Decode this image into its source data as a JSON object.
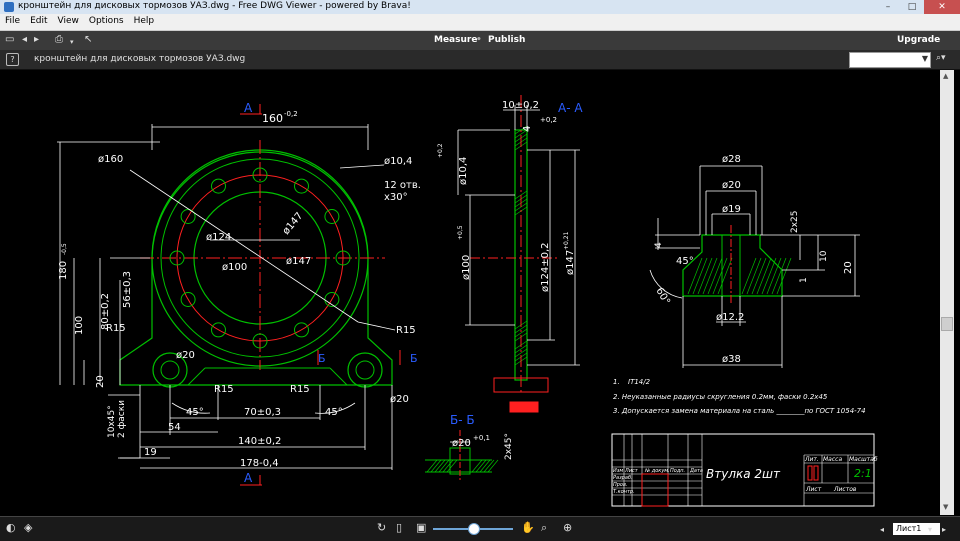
{
  "window": {
    "title": "кронштейн для дисковых тормозов УАЗ.dwg - Free DWG Viewer - powered by Brava!",
    "buttons": [
      "–",
      "□",
      "✕"
    ]
  },
  "menu": {
    "items": [
      "File",
      "Edit",
      "View",
      "Options",
      "Help"
    ]
  },
  "toolbar": {
    "measure": "Measure",
    "publish": "Publish",
    "upgrade": "Upgrade"
  },
  "filebar": {
    "help": "?",
    "filename": "кронштейн для дисковых тормозов УАЗ.dwg",
    "search_value": ""
  },
  "bottom": {
    "sheet": "Лист1"
  },
  "drawing": {
    "sectionA": "А",
    "sectionAA": "А- А",
    "sectionB": "Б",
    "sectionBB": "Б- Б",
    "dim_160": "160",
    "dim_160_tol": "-0,2",
    "dia160": "ø160",
    "dia147": "ø147",
    "dia124": "ø124",
    "dia100": "ø100",
    "dia104": "ø10,4",
    "holes": "12 отв.",
    "holes_angle": "x30°",
    "dim_180": "180",
    "dim_180_tol": "-0,5",
    "dim_100": "100",
    "dim_80": "80±0,2",
    "dim_56": "56±0,3",
    "r15": "R15",
    "dia20": "ø20",
    "dim_20": "20",
    "angle45": "45°",
    "dim_70": "70±0,3",
    "dim_54": "54",
    "dim_140": "140±0,2",
    "dim_19": "19",
    "dim_178": "178-0,4",
    "chamfer": "10x45°",
    "chamfer2": "2 фаски",
    "dim_10": "10±0,2",
    "dim_4": "4",
    "tol_02": "+0,2",
    "dim_124v": "ø124±0,2",
    "dim_147v": "ø147",
    "tol_021": "+0,21",
    "dim_100v": "ø100",
    "tol_05": "+0,5",
    "dim_104v": "ø10,4",
    "bb_dia20": "ø20",
    "bb_tol": "+0,1",
    "bb_chamfer": "2x45°",
    "d28": "ø28",
    "d20": "ø20",
    "d19": "ø19",
    "d122": "ø12.2",
    "d38": "ø38",
    "s4": "4",
    "s225": "2x25",
    "s1": "1",
    "s10": "10",
    "s20": "20",
    "s45": "45°",
    "s60": "60°",
    "note1_num": "1.",
    "note1": "IT14/2",
    "note2": "2. Неуказанные радиусы скругления 0.2мм, фаски 0.2x45",
    "note3": "3. Допускается замена материала на сталь ________по ГОСТ 1054-74",
    "tb_name": "Втулка 2шт",
    "tb_lit": "Лит.",
    "tb_mass": "Масса",
    "tb_scale": "Масштаб",
    "tb_scale_val": "2:1",
    "tb_izm": "Изм",
    "tb_list": "Лист",
    "tb_docnum": "№ докум.",
    "tb_sign": "Подп.",
    "tb_date": "Дата",
    "tb_razrab": "Разраб.",
    "tb_prov": "Пров.",
    "tb_tkontr": "Т.контр.",
    "tb_sheet": "Лист",
    "tb_sheets": "Листов"
  },
  "colors": {
    "green": "#00c000",
    "red": "#ff2020",
    "white": "#ffffff",
    "blue": "#2a5cff"
  }
}
